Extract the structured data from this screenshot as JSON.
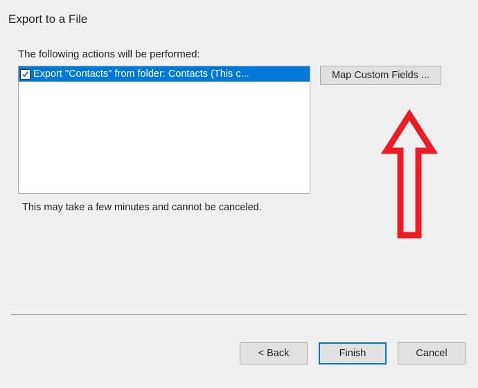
{
  "dialog": {
    "title": "Export to a File",
    "instruction": "The following actions will be performed:",
    "note": "This may take a few minutes and cannot be canceled."
  },
  "list": {
    "items": [
      {
        "checked": true,
        "label": "Export \"Contacts\" from folder: Contacts (This c..."
      }
    ]
  },
  "buttons": {
    "map": "Map Custom Fields ...",
    "back": "< Back",
    "finish": "Finish",
    "cancel": "Cancel"
  },
  "annotation": {
    "arrow_color": "#ed1c24"
  }
}
